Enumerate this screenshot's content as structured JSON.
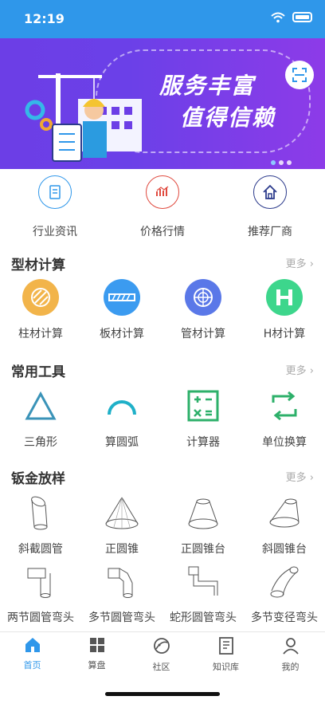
{
  "status_bar": {
    "time": "12:19"
  },
  "banner": {
    "line1": "服务丰富",
    "line2": "值得信赖"
  },
  "quick_links": [
    {
      "label": "行业资讯",
      "icon": "news-icon",
      "color": "#2f97ea"
    },
    {
      "label": "价格行情",
      "icon": "price-chart-icon",
      "color": "#e04a3f"
    },
    {
      "label": "推荐厂商",
      "icon": "home-factory-icon",
      "color": "#2c3b8c"
    }
  ],
  "sections": {
    "profile_calc": {
      "title": "型材计算",
      "more": "更多",
      "items": [
        {
          "label": "柱材计算",
          "icon": "column-material-icon",
          "color": "#f2b44a"
        },
        {
          "label": "板材计算",
          "icon": "plate-material-icon",
          "color": "#3b9bf0"
        },
        {
          "label": "管材计算",
          "icon": "pipe-material-icon",
          "color": "#5a78e8"
        },
        {
          "label": "H材计算",
          "icon": "h-beam-icon",
          "color": "#3dd68c"
        }
      ]
    },
    "tools": {
      "title": "常用工具",
      "more": "更多",
      "items": [
        {
          "label": "三角形",
          "icon": "triangle-icon",
          "color": "#3a93b8"
        },
        {
          "label": "算圆弧",
          "icon": "arc-icon",
          "color": "#1fb0c8"
        },
        {
          "label": "计算器",
          "icon": "calculator-icon",
          "color": "#2db06a"
        },
        {
          "label": "单位换算",
          "icon": "unit-convert-icon",
          "color": "#2db06a"
        }
      ]
    },
    "sheet_metal": {
      "title": "钣金放样",
      "more": "更多",
      "items": [
        {
          "label": "斜截圆管",
          "icon": "oblique-pipe-icon"
        },
        {
          "label": "正圆锥",
          "icon": "cone-icon"
        },
        {
          "label": "正圆锥台",
          "icon": "frustum-icon"
        },
        {
          "label": "斜圆锥台",
          "icon": "oblique-frustum-icon"
        },
        {
          "label": "两节圆管弯头",
          "icon": "two-section-elbow-icon"
        },
        {
          "label": "多节圆管弯头",
          "icon": "multi-section-elbow-icon"
        },
        {
          "label": "蛇形圆管弯头",
          "icon": "snake-elbow-icon"
        },
        {
          "label": "多节变径弯头",
          "icon": "reducing-elbow-icon"
        }
      ]
    }
  },
  "tabbar": [
    {
      "label": "首页",
      "icon": "home-icon",
      "active": true
    },
    {
      "label": "算盘",
      "icon": "grid-icon",
      "active": false
    },
    {
      "label": "社区",
      "icon": "community-icon",
      "active": false
    },
    {
      "label": "知识库",
      "icon": "knowledge-icon",
      "active": false
    },
    {
      "label": "我的",
      "icon": "profile-icon",
      "active": false
    }
  ],
  "colors": {
    "primary": "#2f97ea",
    "banner": "#6c3ee6"
  }
}
